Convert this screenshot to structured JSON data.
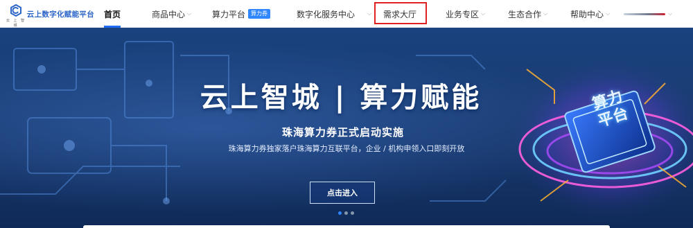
{
  "brand": {
    "logo_sub": "云 上 智 城",
    "name": "云上数字化赋能平台"
  },
  "nav": {
    "items": [
      {
        "label": "首页",
        "dropdown": false,
        "active": true
      },
      {
        "label": "商品中心",
        "dropdown": true
      },
      {
        "label": "算力平台",
        "dropdown": false,
        "badge": "算力券"
      },
      {
        "label": "数字化服务中心",
        "dropdown": true
      },
      {
        "label": "需求大厅",
        "dropdown": false,
        "highlighted": true
      },
      {
        "label": "业务专区",
        "dropdown": true
      },
      {
        "label": "生态合作",
        "dropdown": true
      },
      {
        "label": "帮助中心",
        "dropdown": true
      }
    ],
    "chevron": "⌵"
  },
  "hero": {
    "title": "云上智城 | 算力赋能",
    "subtitle": "珠海算力券正式启动实施",
    "description": "珠海算力券独家落户珠海算力互联平台，企业 / 机构申领入口即刻开放",
    "button_label": "点击进入",
    "chip_text_line1": "算力",
    "chip_text_line2": "平台",
    "carousel": {
      "total": 3,
      "active_index": 0
    }
  },
  "colors": {
    "accent": "#1f6cf2",
    "highlight_border": "#e02020",
    "badge": "#2f86ff"
  }
}
